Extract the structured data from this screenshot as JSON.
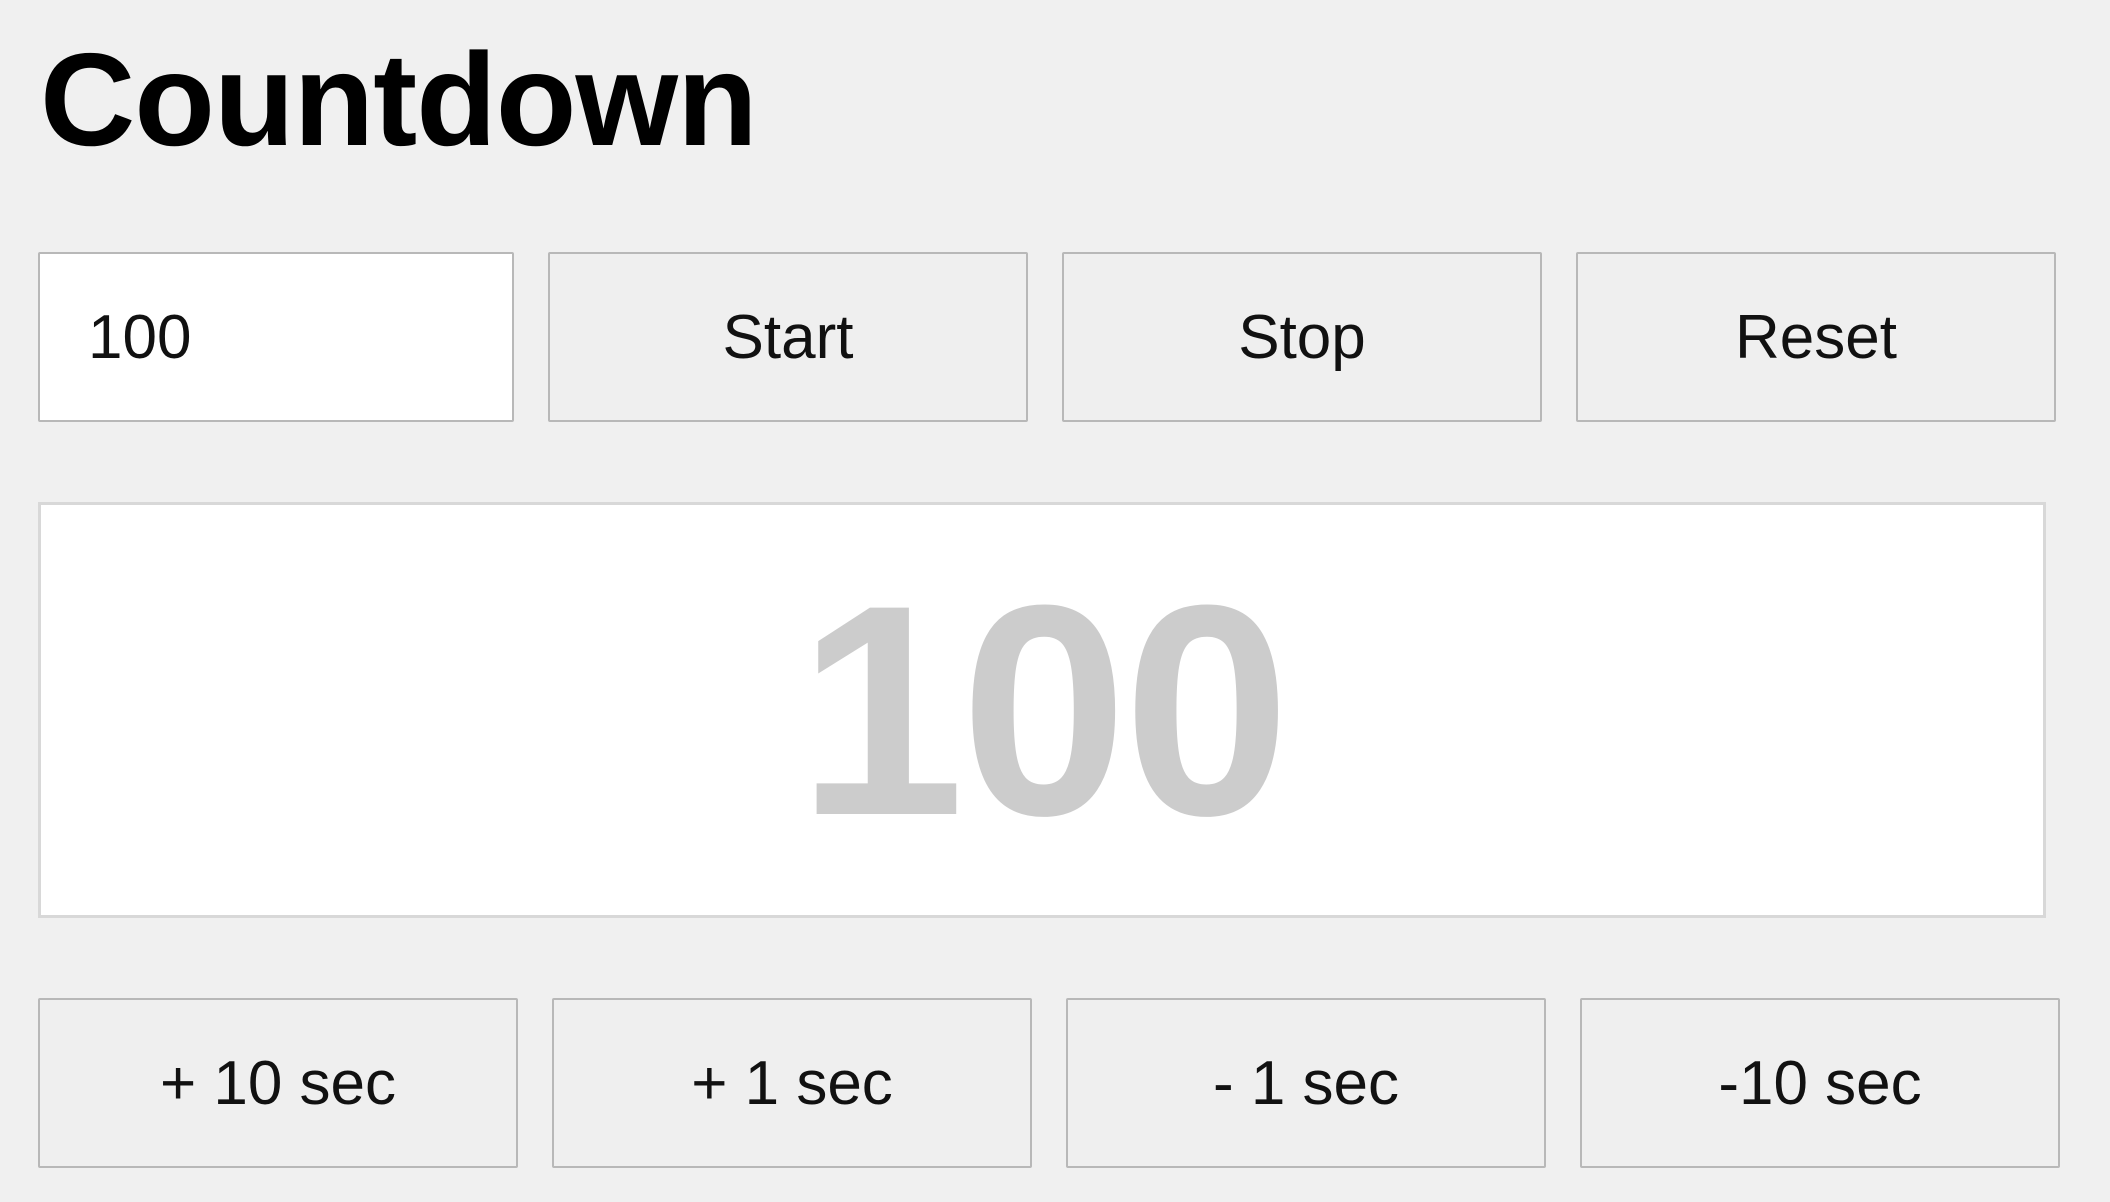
{
  "title": "Countdown",
  "controls": {
    "input_value": "100",
    "start_label": "Start",
    "stop_label": "Stop",
    "reset_label": "Reset"
  },
  "display": {
    "value": "100",
    "color": "#cccccc"
  },
  "adjust": {
    "plus_10_label": "+ 10 sec",
    "plus_1_label": "+ 1 sec",
    "minus_1_label": "- 1 sec",
    "minus_10_label": "-10 sec"
  }
}
